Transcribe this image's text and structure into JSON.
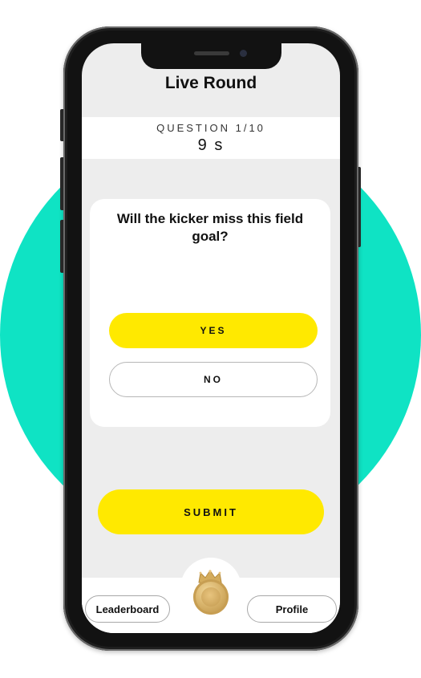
{
  "screen": {
    "title": "Live Round",
    "question_counter": "QUESTION 1/10",
    "timer": "9 s",
    "question_text": "Will the kicker miss this field goal?",
    "options": [
      {
        "label": "YES",
        "selected": true
      },
      {
        "label": "NO",
        "selected": false
      }
    ],
    "submit_label": "SUBMIT"
  },
  "bottom_nav": {
    "leaderboard_label": "Leaderboard",
    "profile_label": "Profile",
    "center_icon": "gold-coin-icon",
    "crown_icon": "crown-icon"
  },
  "colors": {
    "accent_yellow": "#ffe900",
    "background_teal": "#0fe3c4",
    "screen_bg": "#ededed"
  }
}
